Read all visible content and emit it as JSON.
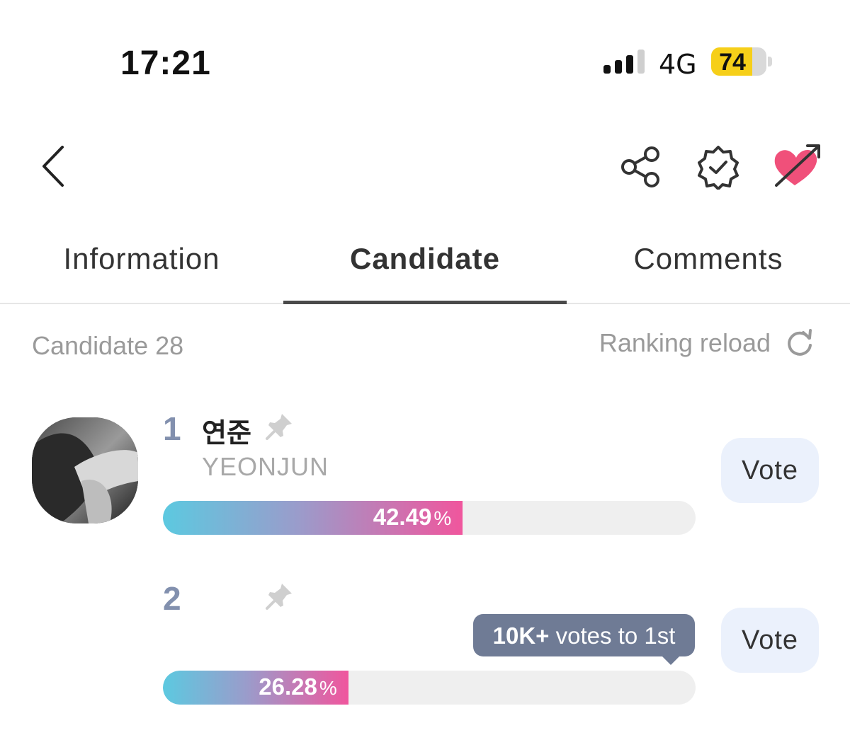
{
  "status_bar": {
    "time": "17:21",
    "network": "4G",
    "battery": "74",
    "battery_color": "#f6cf19"
  },
  "header": {
    "icons": [
      "back-chevron-icon",
      "share-icon",
      "verified-badge-icon",
      "cupid-heart-icon"
    ],
    "heart_color": "#f0507a"
  },
  "tabs": [
    {
      "label": "Information",
      "active": false
    },
    {
      "label": "Candidate",
      "active": true
    },
    {
      "label": "Comments",
      "active": false
    }
  ],
  "list_header": {
    "count_label": "Candidate 28",
    "reload_label": "Ranking reload"
  },
  "candidates": [
    {
      "rank": "1",
      "name": "연준",
      "name_en": "YEONJUN",
      "percent": "42.49",
      "percent_value": 42.49,
      "unit": "%",
      "vote_label": "Vote"
    },
    {
      "rank": "2",
      "name": "",
      "name_en": "",
      "percent": "26.28",
      "percent_value": 26.28,
      "unit": "%",
      "vote_label": "Vote",
      "tooltip": {
        "strong": "10K+",
        "text": " votes to 1st"
      }
    }
  ],
  "colors": {
    "accent_start": "#5cc9e0",
    "accent_end": "#f0569d",
    "vote_bg": "#ebf1fc",
    "tooltip_bg": "#6f7b95",
    "rank_color": "#8290ae"
  }
}
